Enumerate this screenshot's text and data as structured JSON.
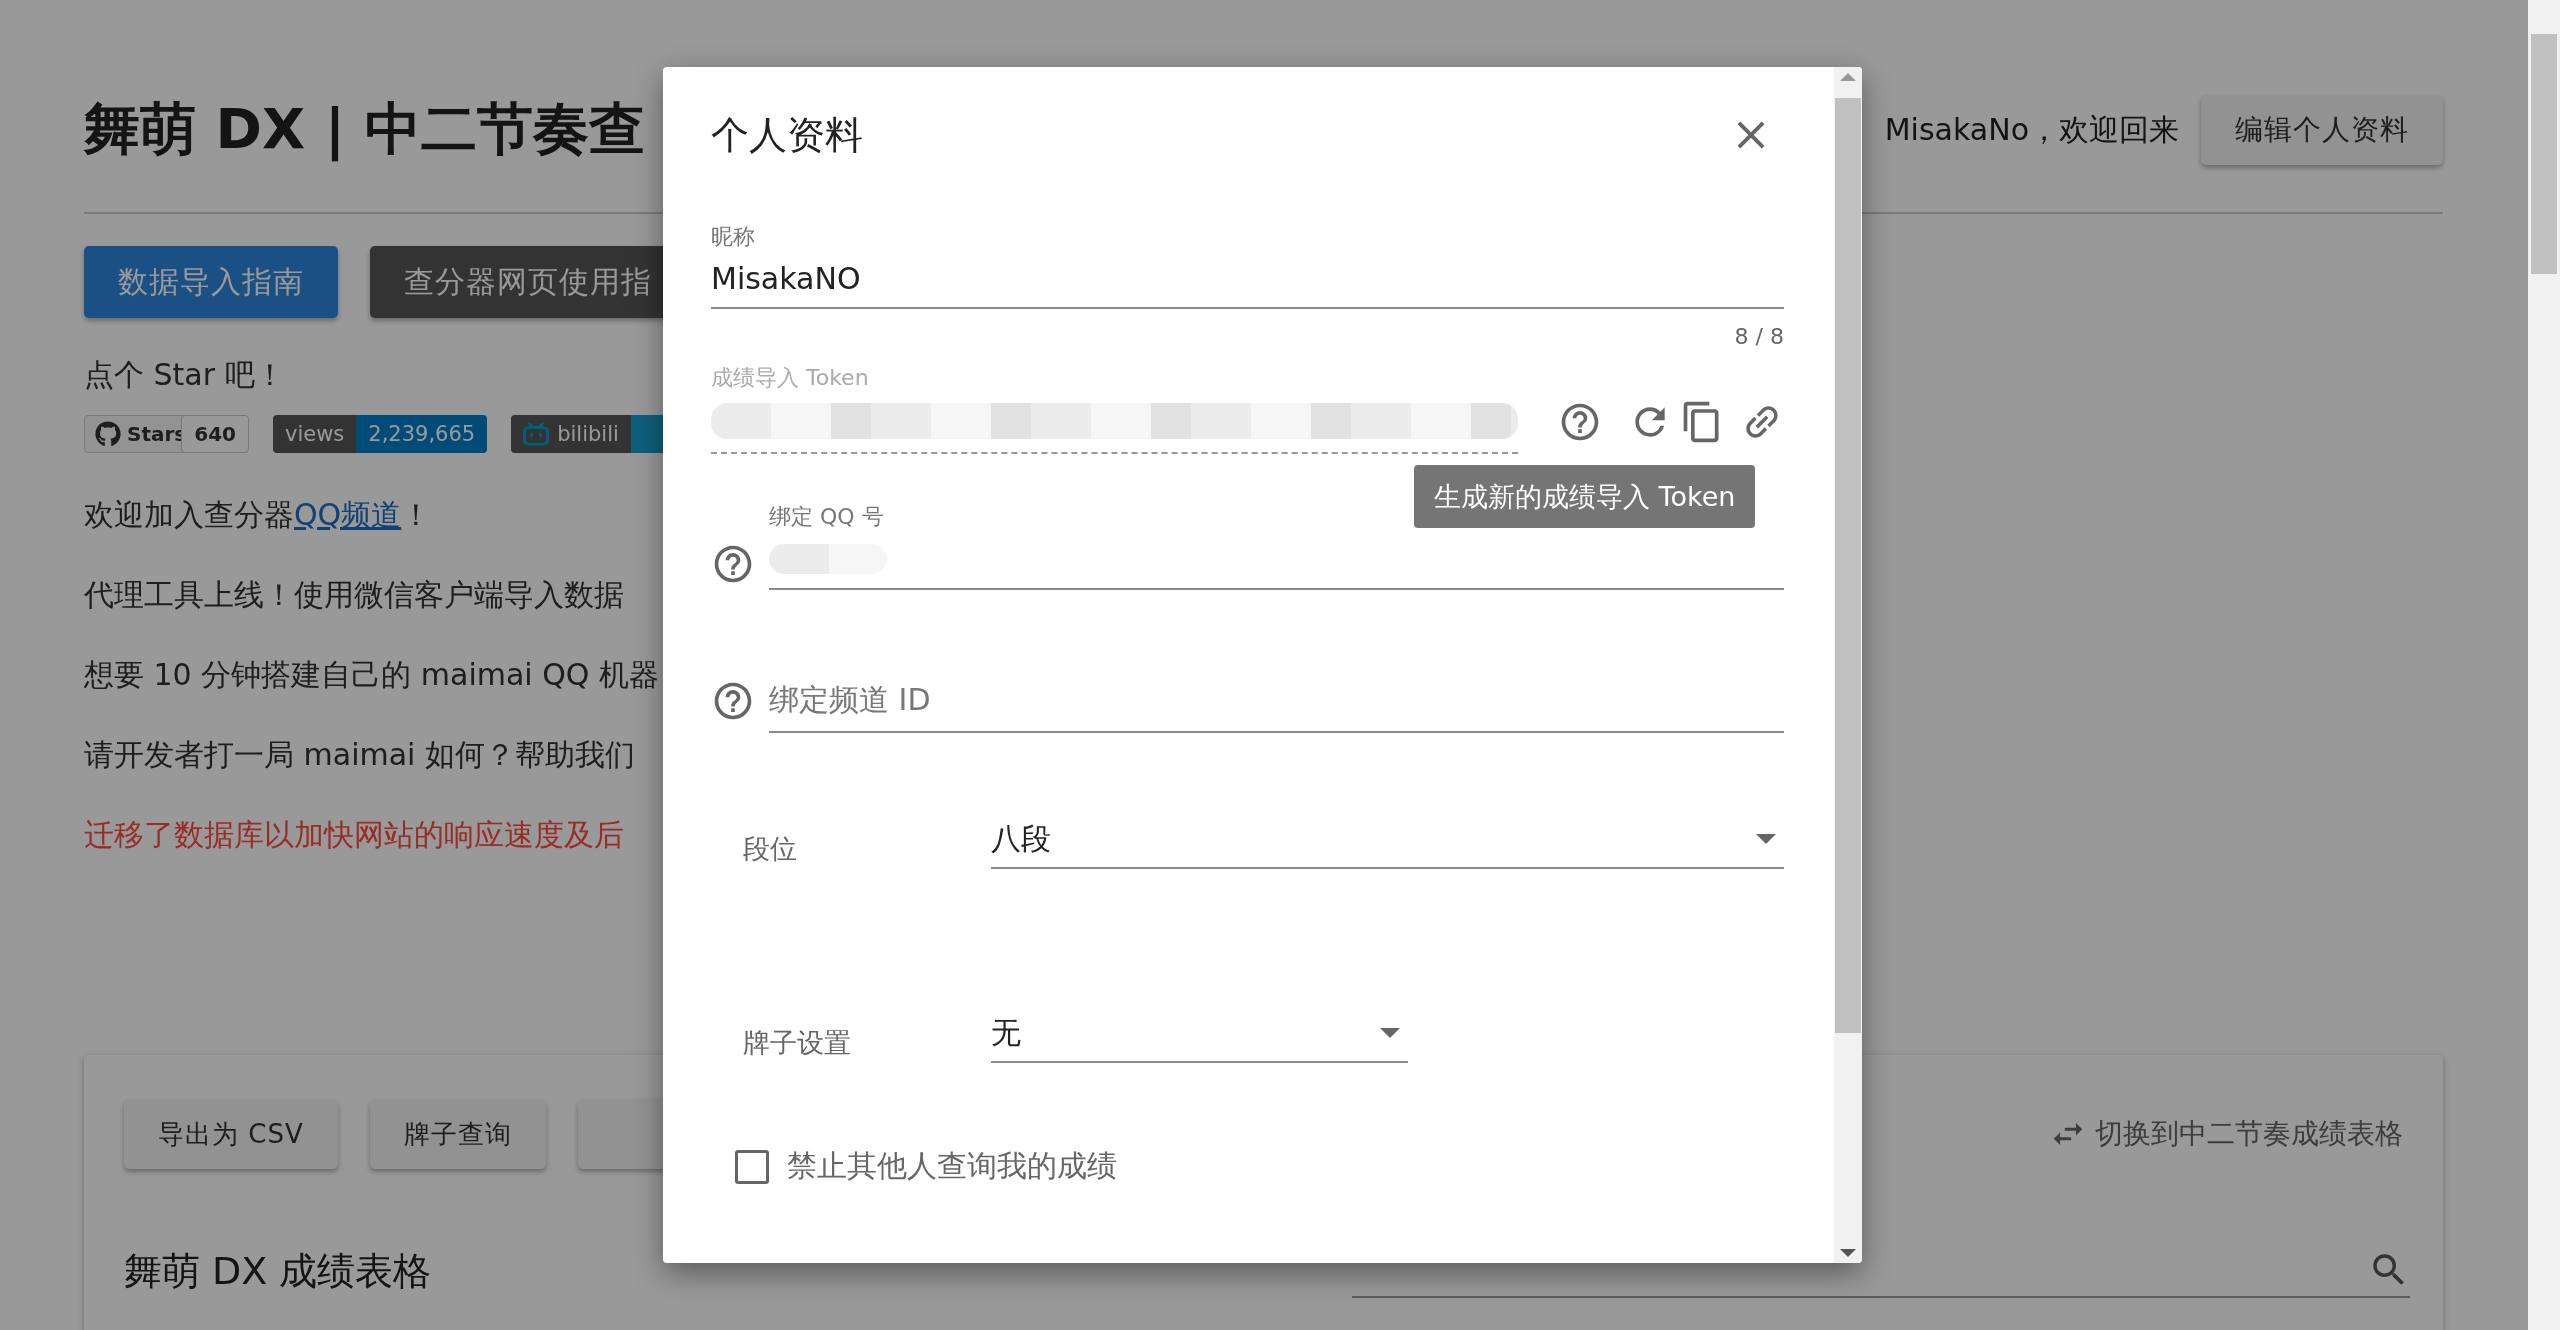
{
  "page": {
    "title": "舞萌 DX | 中二节奏查",
    "greeting": "MisakaNo，欢迎回来",
    "edit_button": "编辑个人资料",
    "buttons": [
      {
        "label": "数据导入指南",
        "kind": "primary"
      },
      {
        "label": "查分器网页使用指",
        "kind": "dark"
      }
    ],
    "star_prompt": "点个 Star 吧！",
    "badges": [
      {
        "kind": "github",
        "label": "Stars",
        "value": "640"
      },
      {
        "kind": "counter",
        "label": "views",
        "value": "2,239,665"
      },
      {
        "kind": "bilibili",
        "label": "bilibili"
      }
    ],
    "paragraphs": [
      {
        "kind": "normal",
        "parts": [
          {
            "text": "欢迎加入查分器",
            "link": false
          },
          {
            "text": "QQ频道",
            "link": true
          },
          {
            "text": "！",
            "link": false
          }
        ]
      },
      {
        "kind": "normal",
        "parts": [
          {
            "text": "代理工具上线！使用微信客户端导入数据",
            "link": false
          }
        ]
      },
      {
        "kind": "normal",
        "parts": [
          {
            "text": "想要 10 分钟搭建自己的 maimai QQ 机器",
            "link": false
          }
        ]
      },
      {
        "kind": "normal",
        "parts": [
          {
            "text": "请开发者打一局 maimai 如何？帮助我们",
            "link": false
          }
        ]
      },
      {
        "kind": "alert",
        "parts": [
          {
            "text": "迁移了数据库以加快网站的响应速度及后",
            "link": false
          }
        ]
      }
    ],
    "records": {
      "buttons": [
        "导出为 CSV",
        "牌子查询"
      ],
      "switch_link": "切换到中二节奏成绩表格",
      "table_title": "舞萌 DX 成绩表格"
    }
  },
  "dialog": {
    "title": "个人资料",
    "nickname": {
      "label": "昵称",
      "value": "MisakaNO",
      "counter": "8 / 8"
    },
    "token": {
      "label": "成绩导入 Token",
      "disabled": true,
      "tooltip": "生成新的成绩导入 Token"
    },
    "qq": {
      "label": "绑定 QQ 号"
    },
    "channel": {
      "placeholder": "绑定频道 ID"
    },
    "rank": {
      "label": "段位",
      "value": "八段"
    },
    "plate": {
      "label": "牌子设置",
      "value": "无"
    },
    "private": {
      "label": "禁止其他人查询我的成绩",
      "checked": false
    }
  }
}
